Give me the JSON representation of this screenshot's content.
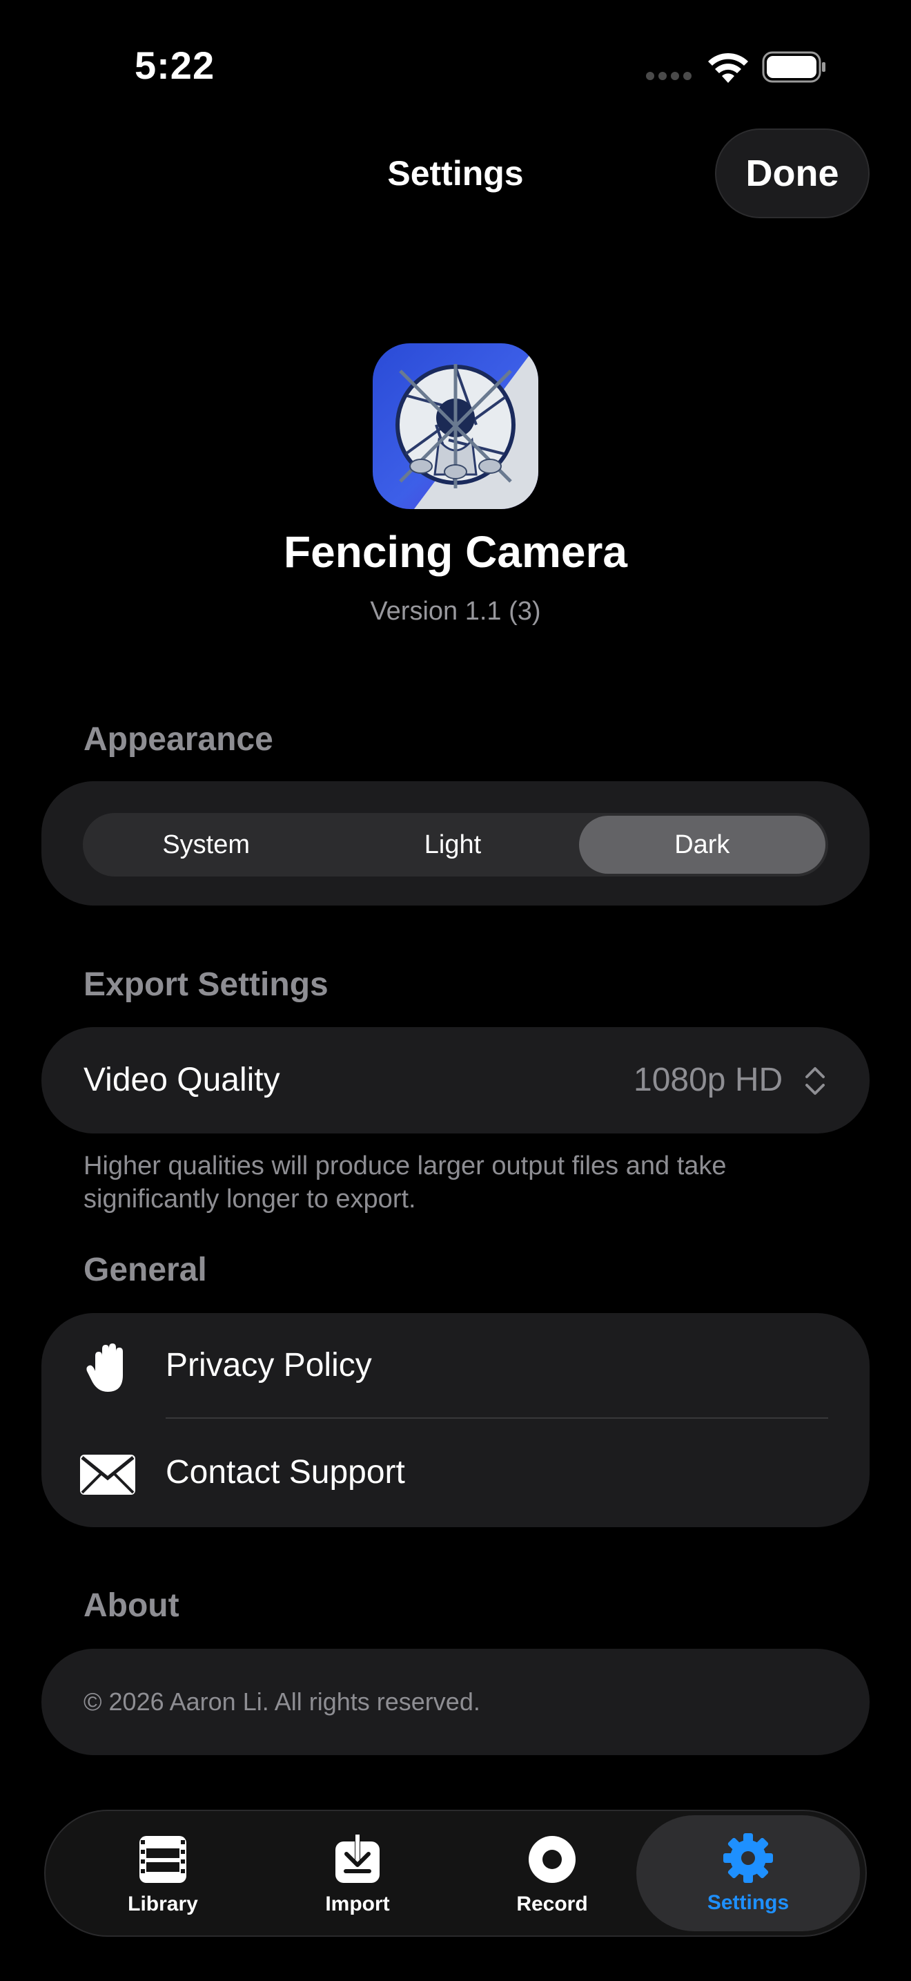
{
  "status_bar": {
    "time": "5:22"
  },
  "header": {
    "title": "Settings",
    "done_label": "Done"
  },
  "app": {
    "name": "Fencing Camera",
    "version": "Version 1.1 (3)"
  },
  "appearance": {
    "header": "Appearance",
    "options": [
      "System",
      "Light",
      "Dark"
    ],
    "selected": "Dark"
  },
  "export": {
    "header": "Export Settings",
    "video_quality_label": "Video Quality",
    "video_quality_value": "1080p HD",
    "note": "Higher qualities will produce larger output files and take significantly longer to export."
  },
  "general": {
    "header": "General",
    "items": [
      {
        "label": "Privacy Policy",
        "icon": "hand-raised-icon"
      },
      {
        "label": "Contact Support",
        "icon": "envelope-icon"
      }
    ]
  },
  "about": {
    "header": "About",
    "copyright": "© 2026 Aaron Li. All rights reserved."
  },
  "tabbar": {
    "tabs": [
      {
        "label": "Library",
        "icon": "film-icon"
      },
      {
        "label": "Import",
        "icon": "tray-download-icon"
      },
      {
        "label": "Record",
        "icon": "record-icon"
      },
      {
        "label": "Settings",
        "icon": "gear-icon"
      }
    ],
    "active": "Settings"
  },
  "colors": {
    "accent": "#1e90ff",
    "background": "#000000",
    "card": "#1c1c1e"
  }
}
